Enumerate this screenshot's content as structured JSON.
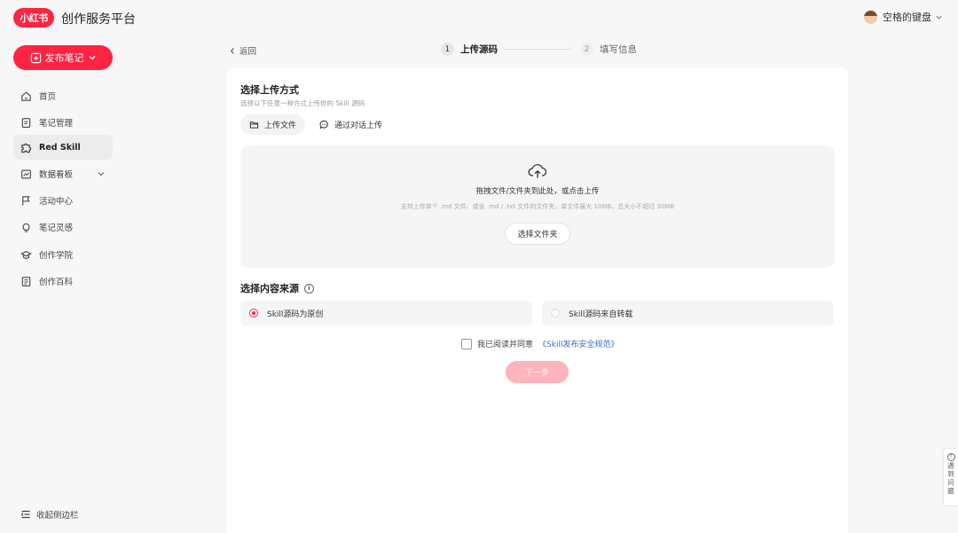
{
  "header": {
    "logo_text": "小红书",
    "platform_name": "创作服务平台",
    "user_name": "空格的键盘"
  },
  "sidebar": {
    "publish_label": "发布笔记",
    "items": [
      {
        "label": "首页",
        "icon": "home-icon"
      },
      {
        "label": "笔记管理",
        "icon": "note-icon"
      },
      {
        "label": "Red Skill",
        "icon": "puzzle-icon",
        "active": true
      },
      {
        "label": "数据看板",
        "icon": "chart-icon",
        "has_submenu": true
      },
      {
        "label": "活动中心",
        "icon": "flag-icon"
      },
      {
        "label": "笔记灵感",
        "icon": "bulb-icon"
      },
      {
        "label": "创作学院",
        "icon": "graduation-icon"
      },
      {
        "label": "创作百科",
        "icon": "book-icon"
      }
    ],
    "collapse_label": "收起侧边栏"
  },
  "steps": {
    "back_label": "返回",
    "items": [
      {
        "num": "1",
        "label": "上传源码",
        "active": true
      },
      {
        "num": "2",
        "label": "填写信息",
        "active": false
      }
    ]
  },
  "upload": {
    "title": "选择上传方式",
    "subtitle": "选择以下任意一种方式上传你的 Skill 源码",
    "tabs": [
      {
        "label": "上传文件",
        "icon": "folder-icon",
        "active": true
      },
      {
        "label": "通过对话上传",
        "icon": "chat-icon",
        "active": false
      }
    ],
    "drop_main": "拖拽文件/文件夹到此处，或点击上传",
    "drop_hint": "支持上传单个 .md 文件、或含 .md / .txt 文件的文件夹，单文件最大 10MB，总大小不超过 30MB",
    "folder_button": "选择文件夹"
  },
  "source": {
    "title": "选择内容来源",
    "options": [
      {
        "label": "Skill源码为原创",
        "checked": true
      },
      {
        "label": "Skill源码来自转载",
        "checked": false
      }
    ]
  },
  "agreement": {
    "prefix": "我已阅读并同意",
    "link": "《Skill发布安全规范》"
  },
  "next_button": "下一步",
  "feedback": "遇到问题",
  "colors": {
    "brand": "#ff2442",
    "next_disabled": "#ffb3bd",
    "link": "#3b6bc4"
  }
}
